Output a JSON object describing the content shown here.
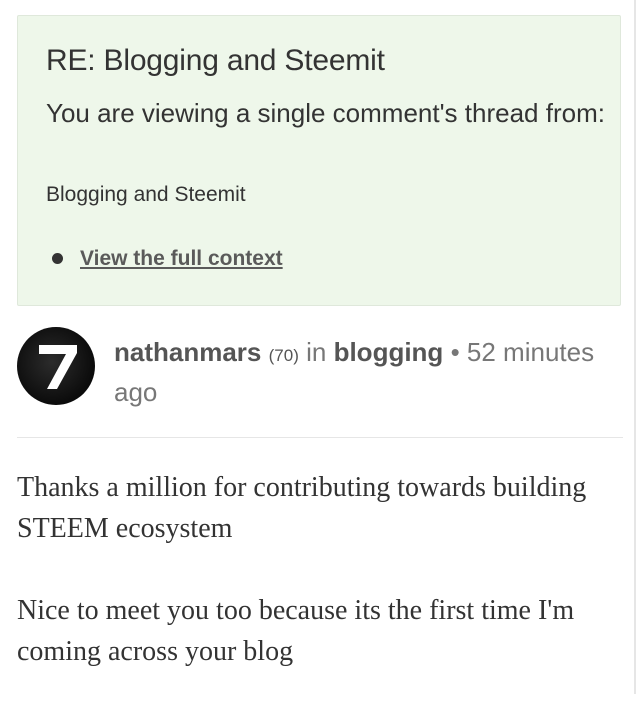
{
  "context": {
    "title": "RE: Blogging and Steemit",
    "description": "You are viewing a single comment's thread from:",
    "parent_post_link": "Blogging and Steemit",
    "view_full_context": "View the full context"
  },
  "comment": {
    "avatar_icon": "avatar-7-icon",
    "author": "nathanmars",
    "reputation": "(70)",
    "in_label": "in",
    "community": "blogging",
    "separator": "•",
    "timestamp": "52 minutes ago",
    "paragraphs": [
      "Thanks a million for contributing towards building STEEM ecosystem",
      "Nice to meet you too because its the first time I'm coming across your blog"
    ]
  },
  "colors": {
    "context_background": "#eef7ea",
    "text": "#333333",
    "muted": "#777777"
  }
}
